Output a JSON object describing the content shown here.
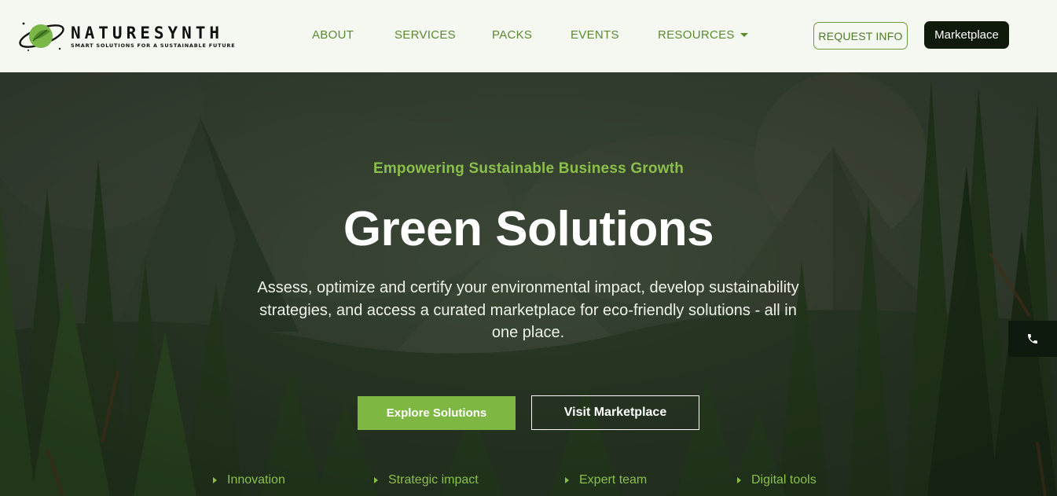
{
  "header": {
    "brand": {
      "name": "NATURESYNTH",
      "tagline": "SMART SOLUTIONS FOR A SUSTAINABLE FUTURE"
    },
    "nav": [
      {
        "label": "ABOUT"
      },
      {
        "label": "SERVICES"
      },
      {
        "label": "PACKS"
      },
      {
        "label": "EVENTS"
      },
      {
        "label": "RESOURCES",
        "has_dropdown": true
      }
    ],
    "request_info_label": "REQUEST INFO",
    "marketplace_label": "Marketplace"
  },
  "hero": {
    "eyebrow": "Empowering Sustainable Business Growth",
    "headline": "Green Solutions",
    "lead": "Assess, optimize and certify your environmental impact, develop sustainability strategies, and access a curated marketplace for eco-friendly solutions - all in one place.",
    "primary_cta": "Explore Solutions",
    "secondary_cta": "Visit Marketplace",
    "features": [
      "Innovation",
      "Strategic impact",
      "Expert team",
      "Digital tools"
    ]
  },
  "colors": {
    "accent_green": "#7eb843",
    "nav_green": "#5a8a30",
    "dark": "#0f1a0b",
    "header_bg": "#f5f7f1"
  },
  "icons": {
    "logo": "planet-leaf-icon",
    "resources_caret": "chevron-down-icon",
    "feature_bullet": "triangle-right-icon",
    "floating_contact": "phone-icon"
  }
}
